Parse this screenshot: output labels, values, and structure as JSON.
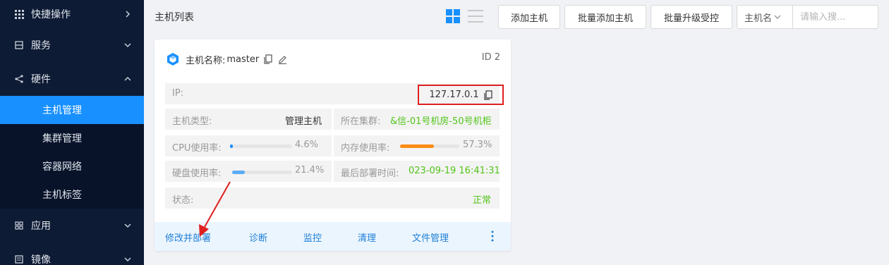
{
  "sidebar": {
    "items": [
      {
        "label": "快捷操作",
        "icon": "grid-icon",
        "chevron": "chevron-right-icon"
      },
      {
        "label": "服务",
        "icon": "server-icon",
        "chevron": "chevron-down-icon"
      },
      {
        "label": "硬件",
        "icon": "share-icon",
        "chevron": "chevron-up-icon"
      },
      {
        "label": "应用",
        "icon": "apps-icon",
        "chevron": "chevron-down-icon"
      },
      {
        "label": "镜像",
        "icon": "image-icon",
        "chevron": "chevron-down-icon"
      }
    ],
    "sub_items": [
      {
        "label": "主机管理",
        "active": true
      },
      {
        "label": "集群管理",
        "active": false
      },
      {
        "label": "容器网络",
        "active": false
      },
      {
        "label": "主机标签",
        "active": false
      }
    ]
  },
  "header": {
    "title": "主机列表",
    "add_host": "添加主机",
    "batch_add": "批量添加主机",
    "batch_upgrade": "批量升级受控",
    "filter_select": "主机名",
    "search_placeholder": "请输入搜..."
  },
  "card": {
    "name_label": "主机名称:",
    "name_value": "master",
    "id_text": "ID 2",
    "ip_label": "IP:",
    "ip_value": "127.17.0.1",
    "type_label": "主机类型:",
    "type_value": "管理主机",
    "cluster_label": "所在集群:",
    "cluster_value": "&信-01号机房-50号机柜",
    "cpu_label": "CPU使用率:",
    "cpu_value": "4.6%",
    "cpu_fraction": 0.046,
    "mem_label": "内存使用率:",
    "mem_value": "57.3%",
    "mem_fraction": 0.573,
    "disk_label": "硬盘使用率:",
    "disk_value": "21.4%",
    "disk_fraction": 0.214,
    "deploy_label": "最后部署时间:",
    "deploy_value": "023-09-19 16:41:31",
    "status_label": "状态:",
    "status_value": "正常"
  },
  "actions": {
    "modify_deploy": "修改并部署",
    "diagnose": "诊断",
    "monitor": "监控",
    "clean": "清理",
    "file_manage": "文件管理"
  },
  "colors": {
    "sidebar_bg": "#0e1b34",
    "active_blue": "#1890ff",
    "cpu_bar": "#1890ff",
    "mem_bar": "#fa8c16",
    "disk_bar": "#5aabf5",
    "green_text": "#52c41a",
    "highlight_red": "#e02020"
  }
}
